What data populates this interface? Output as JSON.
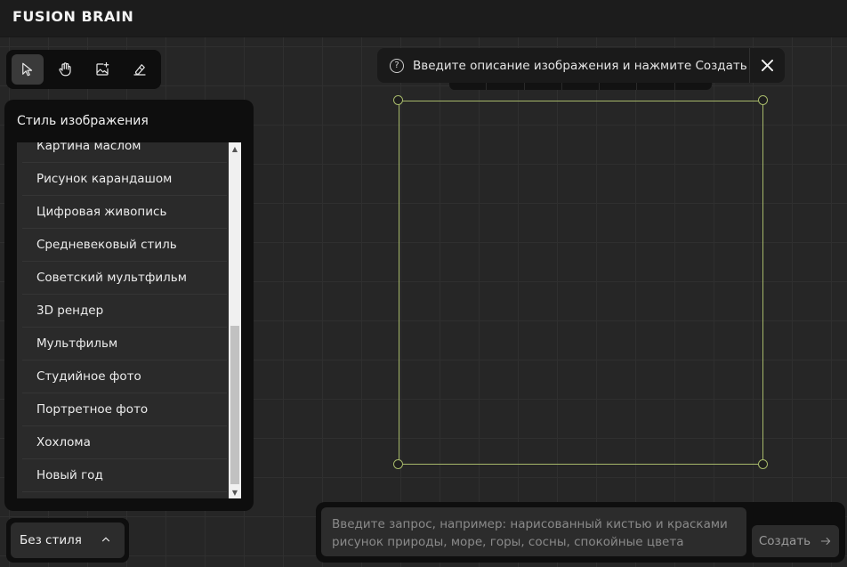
{
  "header": {
    "logo": "FUSION BRAIN"
  },
  "toolbar": {
    "tools": [
      {
        "name": "select",
        "icon": "cursor-arrow-icon",
        "active": true
      },
      {
        "name": "hand",
        "icon": "hand-icon",
        "active": false
      },
      {
        "name": "add-image",
        "icon": "image-plus-icon",
        "active": false
      },
      {
        "name": "eraser",
        "icon": "eraser-icon",
        "active": false
      }
    ]
  },
  "style_panel": {
    "title": "Стиль изображения",
    "items": [
      "Картина маслом",
      "Рисунок карандашом",
      "Цифровая живопись",
      "Средневековый стиль",
      "Советский мультфильм",
      "3D рендер",
      "Мультфильм",
      "Студийное фото",
      "Портретное фото",
      "Хохлома",
      "Новый год"
    ]
  },
  "style_select": {
    "label": "Без стиля"
  },
  "hint": {
    "text": "Введите описание изображения и нажмите Создать"
  },
  "prompt": {
    "placeholder": "Введите запрос, например: нарисованный кистью и красками рисунок природы, море, горы, сосны, спокойные цвета",
    "value": ""
  },
  "create_button": {
    "label": "Создать"
  },
  "colors": {
    "accent_frame": "#a6b86a",
    "panel_bg": "#0e0e0e",
    "canvas_bg": "#262626"
  }
}
